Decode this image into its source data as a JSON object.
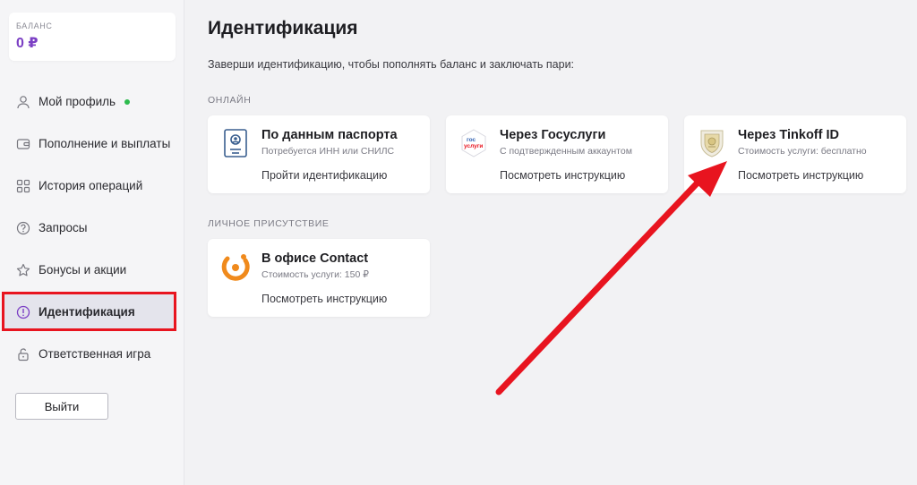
{
  "balance": {
    "label": "БАЛАНС",
    "value": "0 ₽"
  },
  "nav": {
    "items": [
      {
        "label": "Мой профиль",
        "icon": "user-icon"
      },
      {
        "label": "Пополнение и выплаты",
        "icon": "wallet-icon"
      },
      {
        "label": "История операций",
        "icon": "grid-icon"
      },
      {
        "label": "Запросы",
        "icon": "question-icon"
      },
      {
        "label": "Бонусы и акции",
        "icon": "star-icon"
      },
      {
        "label": "Идентификация",
        "icon": "exclamation-icon"
      },
      {
        "label": "Ответственная игра",
        "icon": "lock-icon"
      }
    ],
    "active_index": 5,
    "online_dot_color": "#2dbb4e",
    "highlight_color": "#e8141f"
  },
  "logout_label": "Выйти",
  "main": {
    "title": "Идентификация",
    "subtitle": "Заверши идентификацию, чтобы пополнять баланс и заключать пари:",
    "online_header": "ОНЛАЙН",
    "personal_header": "ЛИЧНОЕ ПРИСУТСТВИЕ",
    "cards": {
      "passport": {
        "title": "По данным паспорта",
        "sub": "Потребуется ИНН или СНИЛС",
        "link": "Пройти идентификацию"
      },
      "gosuslugi": {
        "title": "Через Госуслуги",
        "sub": "С подтвержденным аккаунтом",
        "link": "Посмотреть инструкцию",
        "logo_text_1": "гос",
        "logo_text_2": "услуги"
      },
      "tinkoff": {
        "title": "Через Tinkoff ID",
        "sub": "Стоимость услуги: бесплатно",
        "link": "Посмотреть инструкцию"
      },
      "contact": {
        "title": "В офисе Contact",
        "sub": "Стоимость услуги: 150 ₽",
        "link": "Посмотреть инструкцию"
      }
    }
  },
  "colors": {
    "accent_purple": "#7b3fc4",
    "arrow_red": "#e8141f",
    "contact_orange": "#f08a1c",
    "gosuslugi_blue": "#2f5fb0"
  }
}
